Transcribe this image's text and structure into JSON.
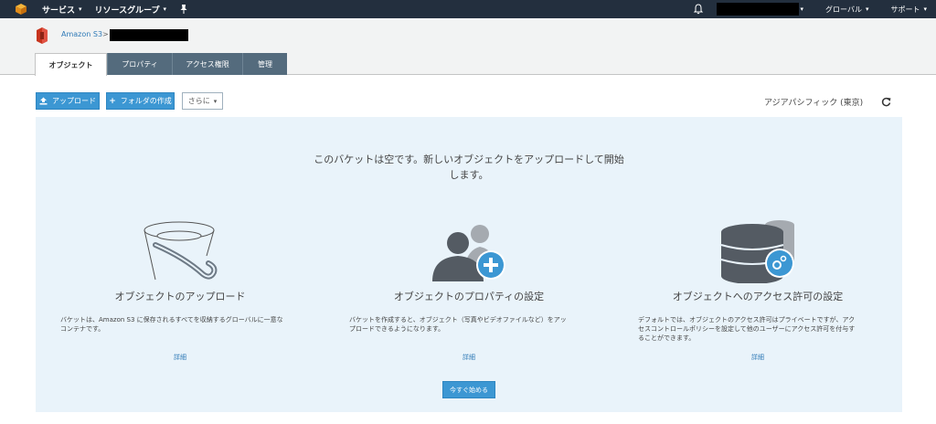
{
  "topnav": {
    "services_label": "サービス",
    "resource_groups_label": "リソースグループ",
    "region_label": "グローバル",
    "support_label": "サポート"
  },
  "breadcrumb": {
    "service_link": "Amazon S3",
    "separator": ">"
  },
  "tabs": [
    {
      "label": "オブジェクト",
      "active": true
    },
    {
      "label": "プロパティ",
      "active": false
    },
    {
      "label": "アクセス権限",
      "active": false
    },
    {
      "label": "管理",
      "active": false
    }
  ],
  "toolbar": {
    "upload_label": "アップロード",
    "create_folder_label": "フォルダの作成",
    "more_label": "さらに"
  },
  "region": "アジアパシフィック (東京)",
  "empty_state": {
    "headline_line1": "このバケットは空です。新しいオブジェクトをアップロードして開始",
    "headline_line2": "します。",
    "columns": [
      {
        "icon": "bucket-icon",
        "title": "オブジェクトのアップロード",
        "desc_line1": "バケットは、Amazon S3 に保存されるすべてを収納するグローバルに一意な",
        "desc_line2": "コンテナです。",
        "desc_line3": "",
        "link": "詳細"
      },
      {
        "icon": "users-add-icon",
        "title": "オブジェクトのプロパティの設定",
        "desc_line1": "バケットを作成すると、オブジェクト（写真やビデオファイルなど）をアッ",
        "desc_line2": "プロードできるようになります。",
        "desc_line3": "",
        "link": "詳細"
      },
      {
        "icon": "database-settings-icon",
        "title": "オブジェクトへのアクセス許可の設定",
        "desc_line1": "デフォルトでは、オブジェクトのアクセス許可はプライベートですが、アク",
        "desc_line2": "セスコントロールポリシーを設定して他のユーザーにアクセス許可を付与す",
        "desc_line3": "ることができます。",
        "link": "詳細"
      }
    ],
    "start_button": "今すぐ始める"
  },
  "colors": {
    "nav_bg": "#232f3e",
    "tab_bg": "#546b7d",
    "primary_button": "#3c97d3",
    "panel_bg": "#e9f3fa",
    "link": "#2f7ab7"
  }
}
